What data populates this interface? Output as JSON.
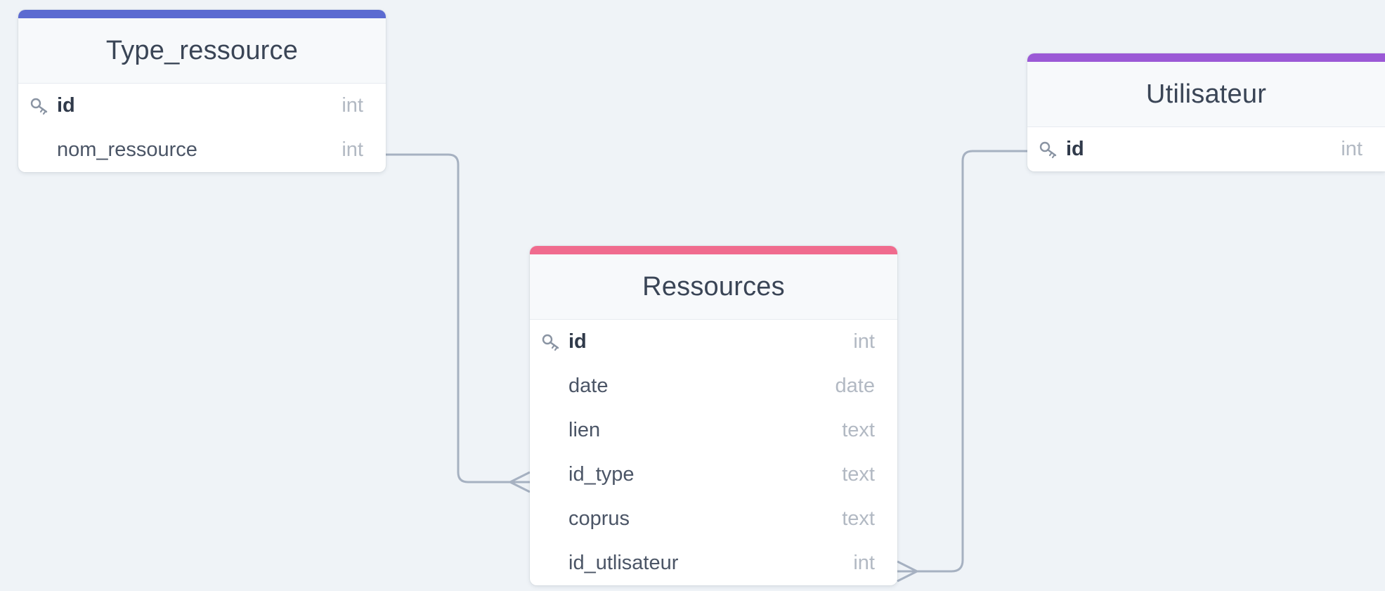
{
  "tables": {
    "type_ressource": {
      "title": "Type_ressource",
      "accent": "#5c6bd1",
      "rows": [
        {
          "name": "id",
          "type": "int",
          "primary_key": true
        },
        {
          "name": "nom_ressource",
          "type": "int",
          "primary_key": false
        }
      ]
    },
    "utilisateur": {
      "title": "Utilisateur",
      "accent": "#9b59d6",
      "rows": [
        {
          "name": "id",
          "type": "int",
          "primary_key": true
        }
      ]
    },
    "ressources": {
      "title": "Ressources",
      "accent": "#f06b8e",
      "rows": [
        {
          "name": "id",
          "type": "int",
          "primary_key": true
        },
        {
          "name": "date",
          "type": "date",
          "primary_key": false
        },
        {
          "name": "lien",
          "type": "text",
          "primary_key": false
        },
        {
          "name": "id_type",
          "type": "text",
          "primary_key": false
        },
        {
          "name": "coprus",
          "type": "text",
          "primary_key": false
        },
        {
          "name": "id_utlisateur",
          "type": "int",
          "primary_key": false
        }
      ]
    }
  },
  "relations": [
    {
      "from": "Type_ressource.nom_ressource",
      "to": "Ressources.id_type",
      "from_cardinality": "one",
      "to_cardinality": "many"
    },
    {
      "from": "Utilisateur.id",
      "to": "Ressources.id_utlisateur",
      "from_cardinality": "one",
      "to_cardinality": "many"
    }
  ],
  "icons": {
    "primary_key": "key-icon",
    "many_end": "crows-foot-icon"
  },
  "colors": {
    "background": "#eff3f7",
    "connector": "#a6b1c1"
  }
}
